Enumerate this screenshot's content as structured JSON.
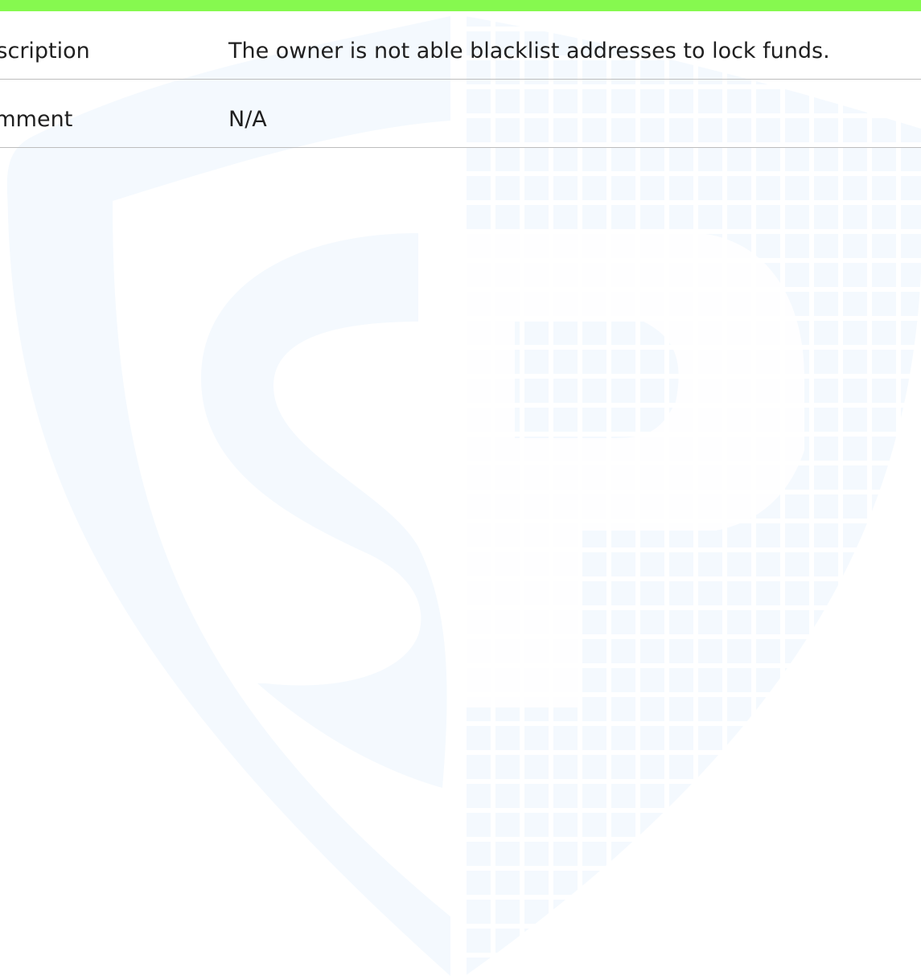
{
  "table": {
    "rows": [
      {
        "label": "Description",
        "value": "The owner is not able blacklist addresses to lock funds."
      },
      {
        "label": "Comment",
        "value": "N/A"
      }
    ]
  },
  "colors": {
    "top_bar": "#86f94f",
    "watermark": "#f4f9fe",
    "divider": "#bdbdbd",
    "text": "#1f1f1f"
  },
  "watermark": {
    "icon": "shield-logo-icon"
  }
}
